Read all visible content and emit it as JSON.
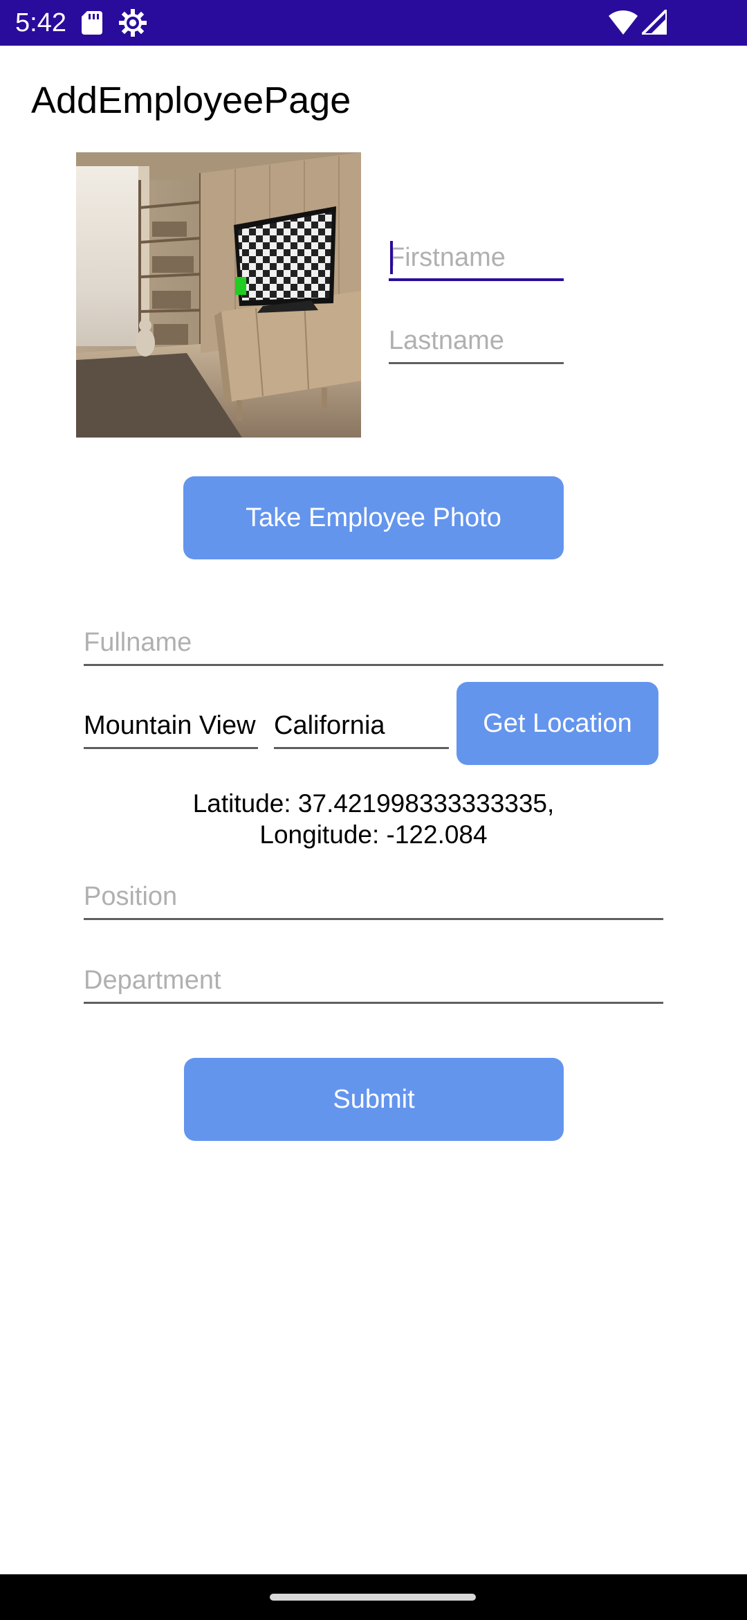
{
  "status_bar": {
    "time": "5:42",
    "background": "#2a0c9c",
    "icons": [
      "sd-card-icon",
      "settings-gear-icon",
      "wifi-icon",
      "cell-signal-icon"
    ]
  },
  "page": {
    "title": "AddEmployeePage"
  },
  "photo": {
    "description_icon": "employee-photo-image"
  },
  "form": {
    "firstname": {
      "placeholder": "Firstname",
      "value": ""
    },
    "lastname": {
      "placeholder": "Lastname",
      "value": ""
    },
    "take_photo_label": "Take Employee Photo",
    "fullname": {
      "placeholder": "Fullname",
      "value": ""
    },
    "city": {
      "value": "Mountain View"
    },
    "state": {
      "value": "California"
    },
    "get_location_label": "Get Location",
    "latitude_text": "Latitude: 37.421998333333335,",
    "longitude_text": "Longitude: -122.084",
    "position": {
      "placeholder": "Position",
      "value": ""
    },
    "department": {
      "placeholder": "Department",
      "value": ""
    },
    "submit_label": "Submit"
  },
  "colors": {
    "accent": "#2a0c9c",
    "button": "#6495ed",
    "underline": "#5f5f5f",
    "placeholder": "#b0b0b0"
  }
}
